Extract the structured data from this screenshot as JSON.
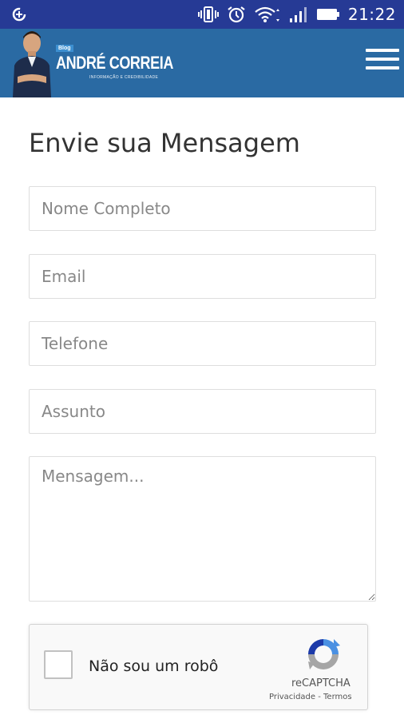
{
  "status_bar": {
    "time": "21:22",
    "icons": [
      "data-saver-icon",
      "vibrate-icon",
      "alarm-icon",
      "wifi-icon",
      "signal-icon",
      "battery-icon"
    ]
  },
  "header": {
    "logo_tag": "Blog",
    "logo_name": "ANDRÉ CORREIA",
    "logo_subtitle": "INFORMAÇÃO E CREDIBILIDADE",
    "menu_icon": "hamburger-menu-icon",
    "background": "#2a6aa3"
  },
  "form": {
    "title": "Envie sua Mensagem",
    "fields": {
      "name_placeholder": "Nome Completo",
      "email_placeholder": "Email",
      "phone_placeholder": "Telefone",
      "subject_placeholder": "Assunto",
      "message_placeholder": "Mensagem..."
    }
  },
  "recaptcha": {
    "label": "Não sou um robô",
    "brand": "reCAPTCHA",
    "privacy": "Privacidade",
    "separator": " - ",
    "terms": "Termos"
  },
  "colors": {
    "status_bar": "#263a95",
    "app_bar": "#2a6aa3",
    "recaptcha_blue": "#1c3aa9",
    "recaptcha_gray": "#a6a6a6"
  }
}
